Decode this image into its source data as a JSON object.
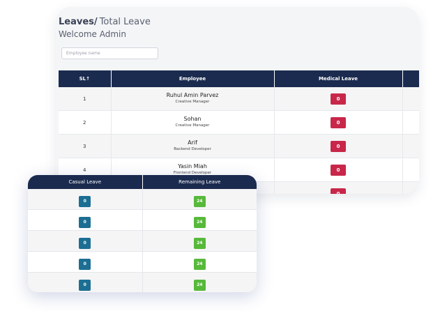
{
  "header": {
    "title_strong": "Leaves/",
    "title_light": "Total Leave",
    "welcome": "Welcome Admin"
  },
  "search": {
    "placeholder": "Employee name",
    "value": ""
  },
  "main_table": {
    "columns": [
      "SL↑",
      "Employee",
      "Medical Leave",
      ""
    ],
    "rows": [
      {
        "sl": "1",
        "name": "Ruhul Amin Parvez",
        "role": "Creative Manager",
        "medical": "0"
      },
      {
        "sl": "2",
        "name": "Sohan",
        "role": "Creative Manager",
        "medical": "0"
      },
      {
        "sl": "3",
        "name": "Arif",
        "role": "Backend Developer",
        "medical": "0"
      },
      {
        "sl": "4",
        "name": "Yasin Miah",
        "role": "Frontend Developer",
        "medical": "0"
      },
      {
        "sl": "",
        "name": "",
        "role": "",
        "medical": "0"
      }
    ]
  },
  "overlay_table": {
    "columns": [
      "Casual Leave",
      "Remaining Leave"
    ],
    "rows": [
      {
        "casual": "0",
        "remaining": "24"
      },
      {
        "casual": "0",
        "remaining": "24"
      },
      {
        "casual": "0",
        "remaining": "24"
      },
      {
        "casual": "0",
        "remaining": "24"
      },
      {
        "casual": "0",
        "remaining": "24"
      }
    ]
  },
  "colors": {
    "header_bg": "#1b2b4f",
    "medical_badge": "#c8274a",
    "casual_badge": "#1c6e93",
    "remaining_badge": "#57b93a"
  }
}
